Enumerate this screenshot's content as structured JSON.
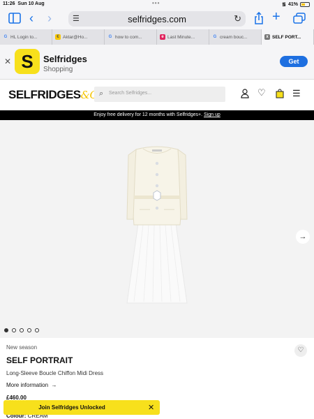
{
  "status_bar": {
    "time": "11:26",
    "date": "Sun 10 Aug",
    "battery": "41%"
  },
  "browser": {
    "url": "selfridges.com",
    "tabs": [
      {
        "favicon": "G",
        "label": "HL  Login to..."
      },
      {
        "favicon": "€",
        "label": "Aktar@Ho..."
      },
      {
        "favicon": "G",
        "label": "how to com..."
      },
      {
        "favicon": "e",
        "label": "Last Minute..."
      },
      {
        "favicon": "G",
        "label": "cream bouc..."
      },
      {
        "favicon": "x",
        "label": "SELF PORT..."
      }
    ]
  },
  "app_banner": {
    "logo_letter": "S",
    "name": "Selfridges",
    "subtitle": "Shopping",
    "get_label": "Get"
  },
  "header": {
    "brand": "SELFRIDGES",
    "brand_suffix": "&Co",
    "search_placeholder": "Search Selfridges..."
  },
  "promo": {
    "text": "Enjoy free delivery for 12 months with Selfridges+.",
    "link": "Sign up"
  },
  "product": {
    "badge": "New season",
    "designer": "SELF PORTRAIT",
    "name": "Long-Sleeve Boucle Chiffon Midi Dress",
    "more_info": "More information",
    "price": "£460.00",
    "colour_label": "Colour:",
    "colour_value": "CREAM"
  },
  "toast": {
    "text": "Join Selfridges Unlocked"
  },
  "colors": {
    "accent": "#f7e01c",
    "link": "#1e6fe0"
  }
}
